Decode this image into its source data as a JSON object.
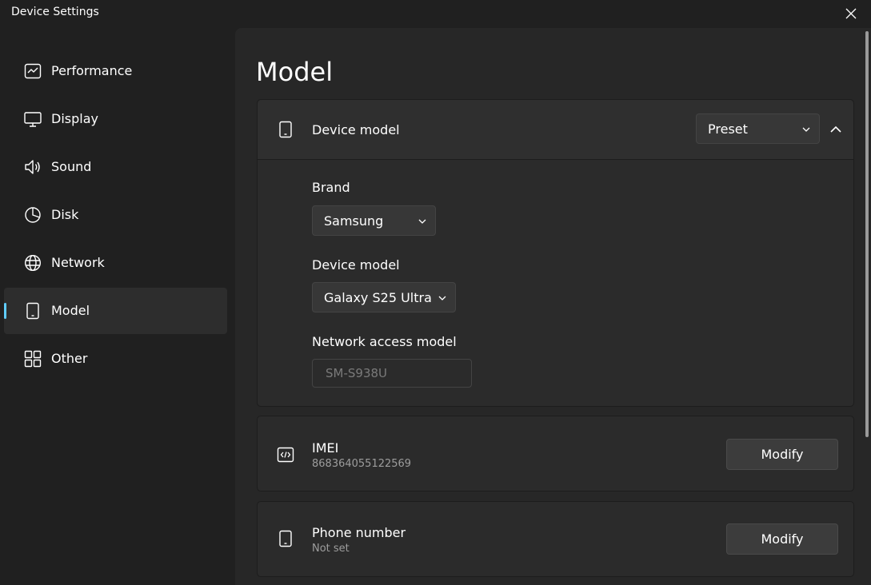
{
  "window": {
    "title": "Device Settings"
  },
  "sidebar": {
    "items": [
      {
        "label": "Performance",
        "icon": "performance-chart-icon"
      },
      {
        "label": "Display",
        "icon": "monitor-icon"
      },
      {
        "label": "Sound",
        "icon": "speaker-icon"
      },
      {
        "label": "Disk",
        "icon": "pie-chart-icon"
      },
      {
        "label": "Network",
        "icon": "globe-icon"
      },
      {
        "label": "Model",
        "icon": "tablet-icon",
        "active": true
      },
      {
        "label": "Other",
        "icon": "grid-icon"
      }
    ]
  },
  "page": {
    "title": "Model"
  },
  "device_model_card": {
    "title": "Device model",
    "mode_dropdown": {
      "selected": "Preset"
    },
    "brand": {
      "label": "Brand",
      "selected": "Samsung"
    },
    "device_model": {
      "label": "Device model",
      "selected": "Galaxy S25 Ultra"
    },
    "network_access_model": {
      "label": "Network access model",
      "placeholder": "SM-S938U"
    }
  },
  "imei_card": {
    "title": "IMEI",
    "value": "868364055122569",
    "button": "Modify"
  },
  "phone_card": {
    "title": "Phone number",
    "value": "Not set",
    "button": "Modify"
  },
  "colors": {
    "accent": "#60cdff",
    "background": "#202020",
    "content": "#272727",
    "card": "#2b2b2b"
  }
}
